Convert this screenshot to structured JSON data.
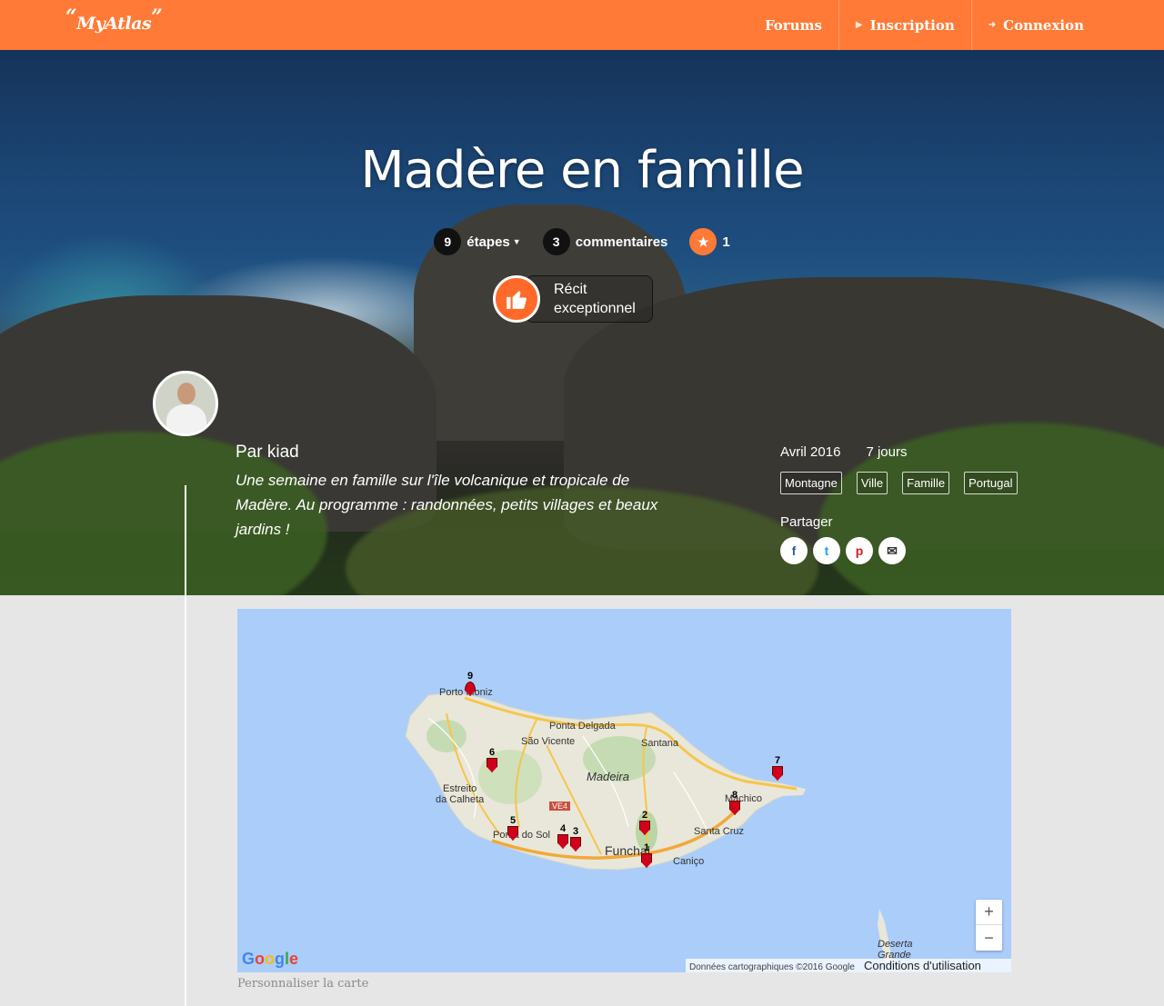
{
  "header": {
    "logo": "MyAtlas",
    "nav": [
      {
        "label": "Forums",
        "icon": ""
      },
      {
        "label": "Inscription",
        "icon": "caret-right-icon"
      },
      {
        "label": "Connexion",
        "icon": "sign-in-icon"
      }
    ]
  },
  "hero": {
    "title": "Madère en famille",
    "stats": {
      "steps_count": "9",
      "steps_label": "étapes",
      "comments_count": "3",
      "comments_label": "commentaires",
      "favorites_count": "1"
    },
    "award": {
      "line1": "Récit",
      "line2": "exceptionnel"
    },
    "author": "Par kiad",
    "description": "Une semaine en famille sur l'île volcanique et tropicale de Madère. Au programme : randonnées, petits villages et beaux jardins !",
    "date": "Avril 2016",
    "duration": "7 jours",
    "tags": [
      "Montagne",
      "Ville",
      "Famille",
      "Portugal"
    ],
    "share_label": "Partager",
    "share_buttons": [
      {
        "label": "f",
        "icon": "facebook-icon",
        "color": "#3b5998"
      },
      {
        "label": "t",
        "icon": "twitter-icon",
        "color": "#1da1f2"
      },
      {
        "label": "p",
        "icon": "pinterest-icon",
        "color": "#cb2027"
      },
      {
        "label": "✉",
        "icon": "email-icon",
        "color": "#333333"
      }
    ]
  },
  "map": {
    "places": {
      "porto_moniz": "Porto Moniz",
      "ponta_delgada": "Ponta Delgada",
      "sao_vicente": "São Vicente",
      "santana": "Santana",
      "madeira": "Madeira",
      "estreito_1": "Estreito",
      "estreito_2": "da Calheta",
      "machico": "Machico",
      "santa_cruz": "Santa Cruz",
      "ponta_do_sol": "Ponta do Sol",
      "funchal": "Funchal",
      "canico": "Caniço",
      "deserta_1": "Deserta",
      "deserta_2": "Grande",
      "road": "VE4"
    },
    "markers": [
      "9",
      "6",
      "5",
      "4",
      "3",
      "2",
      "1",
      "8",
      "7"
    ],
    "zoom_in": "+",
    "zoom_out": "−",
    "google": "Google",
    "attribution": "Données cartographiques ©2016 Google",
    "terms": "Conditions d'utilisation",
    "customize": "Personnaliser la carte"
  },
  "colors": {
    "brand": "#ff7a36",
    "sea": "#abcdfa",
    "land": "#e8e6d8",
    "marker": "#d0021b"
  }
}
